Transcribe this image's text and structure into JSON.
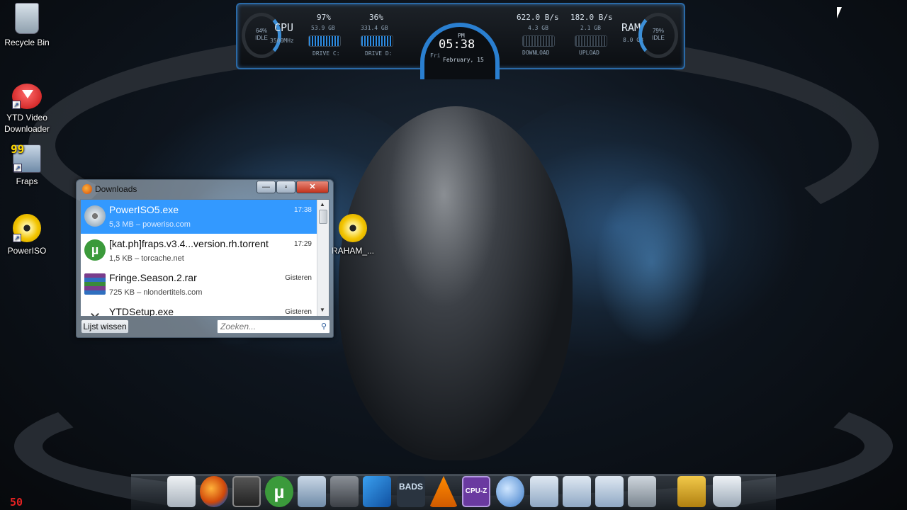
{
  "desktop_icons": [
    {
      "label": "Recycle Bin",
      "icon": "recycle-bin-icon"
    },
    {
      "label": "YTD Video Downloader",
      "icon": "ytd-icon"
    },
    {
      "label": "Fraps",
      "icon": "fraps-icon"
    },
    {
      "label": "PowerISO",
      "icon": "poweriso-disc-icon"
    },
    {
      "label": "RAHAM_...",
      "icon": "disc-image-icon"
    }
  ],
  "gadget": {
    "cpu_label": "CPU",
    "cpu_speed": "3500MHz",
    "cpu_idle": "64%",
    "cpu_idle_label": "IDLE",
    "drive_c_pct": "97%",
    "drive_c_size": "53.9 GB",
    "drive_c_label": "DRIVE C:",
    "drive_d_pct": "36%",
    "drive_d_size": "331.4 GB",
    "drive_d_label": "DRIVE D:",
    "ampm": "PM",
    "time": "05:38",
    "day": "Fri",
    "date": "February, 15",
    "download_speed": "622.0 B/s",
    "download_total": "4.3 GB",
    "download_label": "DOWNLOAD",
    "upload_speed": "182.0 B/s",
    "upload_total": "2.1 GB",
    "upload_label": "UPLOAD",
    "ram_label": "RAM",
    "ram_size": "8.0 GB",
    "ram_idle": "79%",
    "ram_idle_label": "IDLE"
  },
  "downloads_window": {
    "title": "Downloads",
    "minimize": "—",
    "maximize": "▫",
    "close": "✕",
    "items": [
      {
        "name": "PowerISO5.exe",
        "meta": "5,3 MB – poweriso.com",
        "time": "17:38",
        "selected": true,
        "icon": "installer-icon"
      },
      {
        "name": "[kat.ph]fraps.v3.4...version.rh.torrent",
        "meta": "1,5 KB – torcache.net",
        "time": "17:29",
        "selected": false,
        "icon": "utorrent-icon"
      },
      {
        "name": "Fringe.Season.2.rar",
        "meta": "725 KB – nlondertitels.com",
        "time": "Gisteren",
        "selected": false,
        "icon": "winrar-icon"
      },
      {
        "name": "YTDSetup.exe",
        "meta": "",
        "time": "Gisteren",
        "selected": false,
        "icon": "setup-icon"
      }
    ],
    "clear_button": "Lijst wissen",
    "search_placeholder": "Zoeken..."
  },
  "dock": {
    "items": [
      "document-icon",
      "firefox-icon",
      "media-player-icon",
      "utorrent-icon",
      "fraps-icon",
      "game-icon",
      "arrow-app-icon",
      "bads-icon",
      "vlc-icon",
      "cpuz-icon",
      "network-icon",
      "folder-icon",
      "folder-icon",
      "folder-icon",
      "tools-icon",
      "tools-icon",
      "recycle-bin-icon"
    ],
    "bads_label": "BADS",
    "cpuz_label": "CPU-Z"
  },
  "fps_counter": "50"
}
